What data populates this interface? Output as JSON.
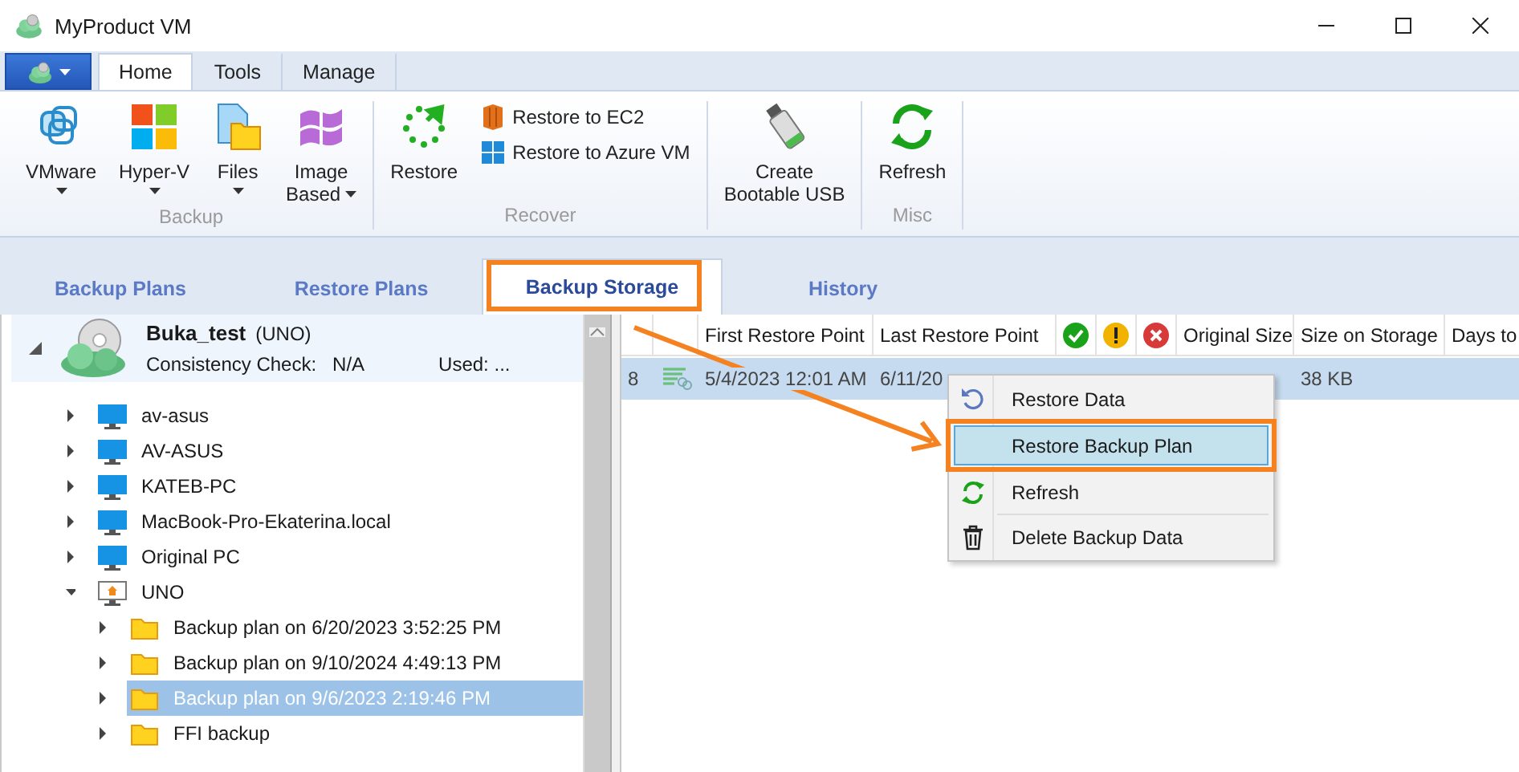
{
  "window": {
    "title": "MyProduct VM"
  },
  "ribbon": {
    "tabs": [
      {
        "label": "Home",
        "selected": true
      },
      {
        "label": "Tools",
        "selected": false
      },
      {
        "label": "Manage",
        "selected": false
      }
    ],
    "groups": [
      {
        "label": "Backup",
        "buttons": [
          {
            "kind": "large",
            "lines": [
              "VMware"
            ],
            "dropdown": true
          },
          {
            "kind": "large",
            "lines": [
              "Hyper-V"
            ],
            "dropdown": true
          },
          {
            "kind": "large",
            "lines": [
              "Files"
            ],
            "dropdown": true
          },
          {
            "kind": "large",
            "lines": [
              "Image",
              "Based"
            ],
            "dropdown": true
          }
        ]
      },
      {
        "label": "Recover",
        "buttons": [
          {
            "kind": "large",
            "lines": [
              "Restore"
            ],
            "dropdown": false
          },
          {
            "kind": "small",
            "lines": [
              "Restore to EC2"
            ]
          },
          {
            "kind": "small",
            "lines": [
              "Restore to Azure VM"
            ]
          }
        ]
      },
      {
        "buttons": [
          {
            "kind": "large",
            "lines": [
              "Create",
              "Bootable USB"
            ],
            "dropdown": false
          }
        ]
      },
      {
        "label": "Misc",
        "buttons": [
          {
            "kind": "large",
            "lines": [
              "Refresh"
            ],
            "dropdown": false
          }
        ]
      }
    ]
  },
  "main_tabs": [
    {
      "label": "Backup Plans",
      "selected": false
    },
    {
      "label": "Restore Plans",
      "selected": false
    },
    {
      "label": "Backup Storage",
      "selected": true
    },
    {
      "label": "History",
      "selected": false
    }
  ],
  "storage": {
    "name": "Buka_test",
    "host": "(UNO)",
    "consistency_label": "Consistency Check:",
    "consistency_value": "N/A",
    "used": "Used: ...",
    "expanded": true
  },
  "tree": [
    {
      "kind": "computer",
      "label": "av-asus",
      "expanded": false,
      "selected": false
    },
    {
      "kind": "computer",
      "label": "AV-ASUS",
      "expanded": false,
      "selected": false
    },
    {
      "kind": "computer",
      "label": "KATEB-PC",
      "expanded": false,
      "selected": false
    },
    {
      "kind": "computer",
      "label": "MacBook-Pro-Ekaterina.local",
      "expanded": false,
      "selected": false
    },
    {
      "kind": "computer",
      "label": "Original PC",
      "expanded": false,
      "selected": false
    },
    {
      "kind": "home",
      "label": "UNO",
      "expanded": true,
      "selected": false,
      "children": [
        {
          "kind": "folder",
          "label": "Backup plan on 6/20/2023 3:52:25 PM",
          "expanded": false,
          "selected": false
        },
        {
          "kind": "folder",
          "label": "Backup plan on 9/10/2024 4:49:13 PM",
          "expanded": false,
          "selected": false
        },
        {
          "kind": "folder",
          "label": "Backup plan on 9/6/2023 2:19:46 PM",
          "expanded": false,
          "selected": true
        },
        {
          "kind": "folder",
          "label": "FFI backup",
          "expanded": false,
          "selected": false
        }
      ]
    }
  ],
  "grid": {
    "columns": [
      {
        "kind": "number"
      },
      {
        "kind": "type"
      },
      {
        "kind": "text",
        "label": "First Restore Point"
      },
      {
        "kind": "text",
        "label": "Last Restore Point"
      },
      {
        "kind": "ok"
      },
      {
        "kind": "warning"
      },
      {
        "kind": "error"
      },
      {
        "kind": "text",
        "label": "Original Size"
      },
      {
        "kind": "text",
        "label": "Size on Storage"
      },
      {
        "kind": "text",
        "label": "Days to"
      }
    ],
    "rows": [
      {
        "selected": true,
        "number": "8",
        "first_restore_point": "5/4/2023 12:01 AM",
        "last_restore_point": "6/11/20",
        "size_on_storage": "38 KB"
      }
    ]
  },
  "context_menu": [
    {
      "label": "Restore Data",
      "selected": false,
      "separator_before": false
    },
    {
      "label": "Restore Backup Plan",
      "selected": true,
      "separator_before": false
    },
    {
      "label": "Refresh",
      "selected": false,
      "separator_before": false
    },
    {
      "label": "Delete Backup Data",
      "selected": false,
      "separator_before": true
    }
  ],
  "annotation": {
    "highlight_selected": true
  }
}
